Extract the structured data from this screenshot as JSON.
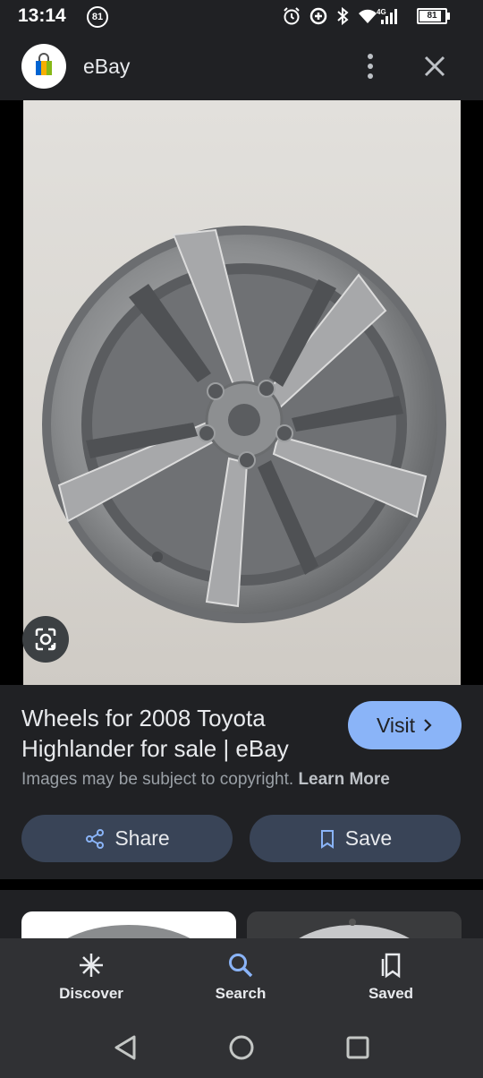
{
  "status": {
    "time": "13:14",
    "notification_count": "81",
    "battery_level": "81",
    "network": "4G"
  },
  "appbar": {
    "title": "eBay"
  },
  "result": {
    "title": "Wheels for 2008 Toyota Highlander for sale | eBay",
    "visit_label": "Visit",
    "copyright_text": "Images may be subject to copyright.",
    "learn_more": "Learn More",
    "share_label": "Share",
    "save_label": "Save"
  },
  "bottom_nav": {
    "items": [
      {
        "label": "Discover",
        "icon": "asterisk-icon"
      },
      {
        "label": "Search",
        "icon": "search-icon",
        "active": true
      },
      {
        "label": "Saved",
        "icon": "saved-icon"
      }
    ]
  },
  "colors": {
    "accent": "#8ab4f8",
    "active_icon": "#8ab4f8",
    "button_bg": "#394457",
    "background": "#202124"
  }
}
